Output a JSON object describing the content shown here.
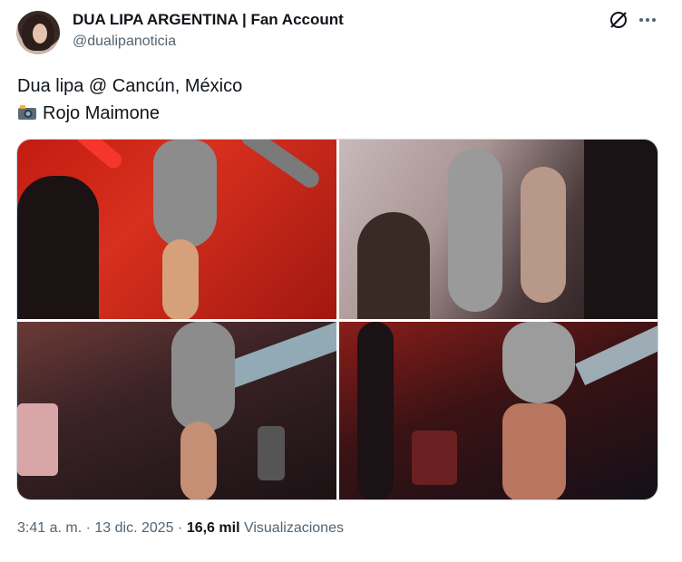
{
  "author": {
    "name": "DUA LIPA ARGENTINA | Fan Account",
    "handle": "@dualipanoticia"
  },
  "tweet": {
    "line1": "Dua lipa @ Cancún, México",
    "line2": "Rojo Maimone",
    "line2_icon": "camera-flash-icon"
  },
  "media": {
    "photos": [
      "photo-1",
      "photo-2",
      "photo-3",
      "photo-4"
    ]
  },
  "meta": {
    "time": "3:41 a. m.",
    "separator": "·",
    "date": "13 dic. 2025",
    "views_count": "16,6 mil",
    "views_label": "Visualizaciones"
  },
  "icons": {
    "grok": "grok-icon",
    "more": "more-icon"
  },
  "colors": {
    "text": "#0f1419",
    "secondary": "#536471",
    "border": "#cfd9de"
  }
}
